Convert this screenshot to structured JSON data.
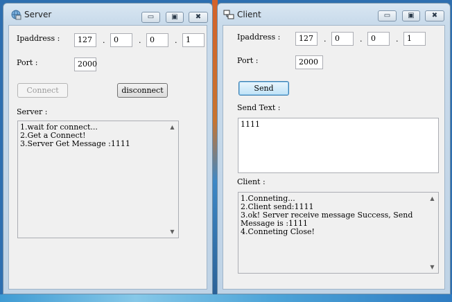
{
  "server_window": {
    "title": "Server",
    "controls": {
      "minimize": "▭",
      "maximize": "▣",
      "close": "✖"
    },
    "ip_label": "Ipaddress :",
    "ip": [
      "127",
      "0",
      "0",
      "1"
    ],
    "port_label": "Port :",
    "port": "2000",
    "connect_label": "Connect",
    "disconnect_label": "disconnect",
    "log_label": "Server :",
    "log": [
      "1.wait for connect...",
      "2.Get a Connect!",
      "3.Server Get Message :1111"
    ]
  },
  "client_window": {
    "title": "Client",
    "controls": {
      "minimize": "▭",
      "maximize": "▣",
      "close": "✖"
    },
    "ip_label": "Ipaddress :",
    "ip": [
      "127",
      "0",
      "0",
      "1"
    ],
    "port_label": "Port :",
    "port": "2000",
    "send_label": "Send",
    "send_text_label": "Send Text :",
    "send_text": "1111",
    "log_label": "Client :",
    "log": [
      "1.Conneting...",
      "2.Client send:1111",
      "3.ok! Server receive message Success, Send Message is :1111",
      "4.Conneting Close!"
    ]
  },
  "ip_separator": ".",
  "scroll_glyphs": {
    "up": "▲",
    "down": "▼"
  }
}
